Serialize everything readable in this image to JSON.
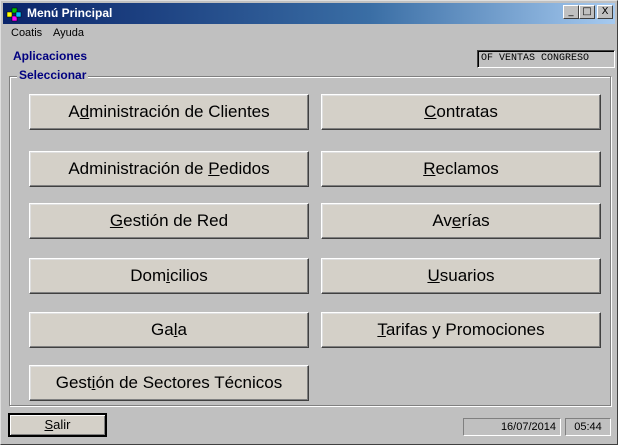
{
  "window": {
    "title": "Menú Principal",
    "controls": {
      "minimize": "_",
      "maximize": "□",
      "close": "X"
    }
  },
  "menubar": {
    "items": [
      "Coatis",
      "Ayuda"
    ]
  },
  "header": {
    "section": "Aplicaciones",
    "office": "OF VENTAS CONGRESO"
  },
  "group": {
    "label": "Seleccionar"
  },
  "buttons": {
    "clientes": {
      "pre": "A",
      "u": "d",
      "post": "ministración de Clientes"
    },
    "contratas": {
      "pre": "",
      "u": "C",
      "post": "ontratas"
    },
    "pedidos": {
      "pre": "Administración de ",
      "u": "P",
      "post": "edidos"
    },
    "reclamos": {
      "pre": "",
      "u": "R",
      "post": "eclamos"
    },
    "red": {
      "pre": "",
      "u": "G",
      "post": "estión de Red"
    },
    "averias": {
      "pre": "Av",
      "u": "e",
      "post": "rías"
    },
    "domicilios": {
      "pre": "Dom",
      "u": "i",
      "post": "cilios"
    },
    "usuarios": {
      "pre": "",
      "u": "U",
      "post": "suarios"
    },
    "gala": {
      "pre": "Ga",
      "u": "l",
      "post": "a"
    },
    "tarifas": {
      "pre": "",
      "u": "T",
      "post": "arifas y Promociones"
    },
    "sectores": {
      "pre": "Gest",
      "u": "i",
      "post": "ón de Sectores Técnicos"
    }
  },
  "footer": {
    "exit": {
      "pre": "",
      "u": "S",
      "post": "alir"
    },
    "date": "16/07/2014",
    "time": "05:44"
  },
  "colors": {
    "title_start": "#0a246a",
    "title_end": "#a6caf0",
    "accent_text": "#000080",
    "face": "#c0c0c0"
  }
}
